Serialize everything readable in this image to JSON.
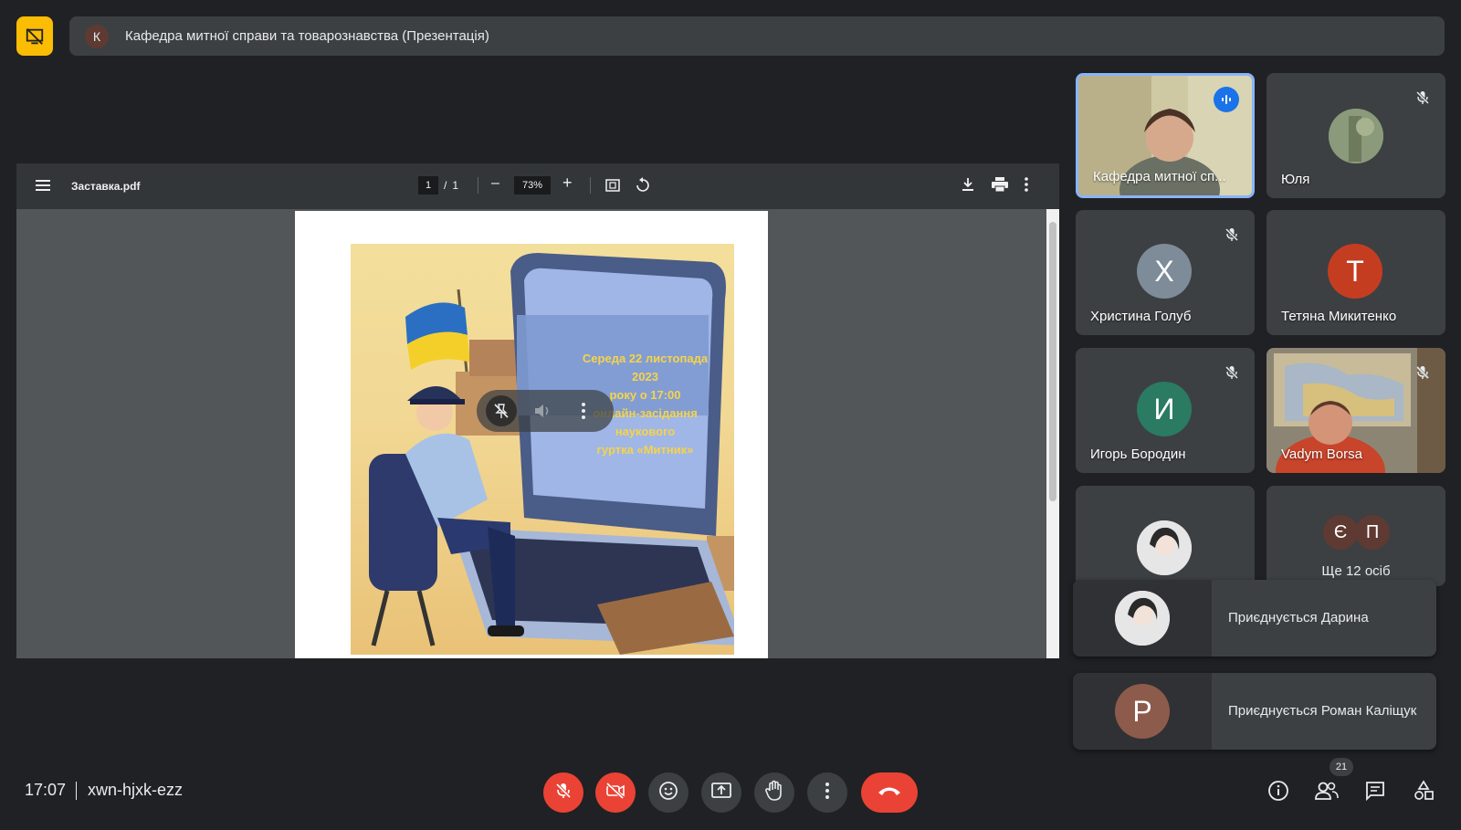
{
  "meeting": {
    "presenter_initial": "К",
    "title": "Кафедра митної справи та товарознавства (Презентація)",
    "time": "17:07",
    "code": "xwn-hjxk-ezz",
    "participant_count": "21"
  },
  "pdf": {
    "filename": "Заставка.pdf",
    "page_current": "1",
    "page_sep": "/",
    "page_total": "1",
    "zoom": "73%",
    "poster_lines": [
      "Середа 22 листопада 2023",
      "року о 17:00",
      "онлайн-засідання наукового",
      "гуртка «Митник»"
    ]
  },
  "tiles": [
    {
      "name": "Кафедра митної сп...",
      "speaking": true
    },
    {
      "name": "Юля",
      "muted": true
    },
    {
      "name": "Христина Голуб",
      "initial": "Х",
      "color": "#7e8b98",
      "muted": true
    },
    {
      "name": "Тетяна Микитенко",
      "initial": "Т",
      "color": "#c53d21"
    },
    {
      "name": "Игорь Бородин",
      "initial": "И",
      "color": "#2b7a62",
      "muted": true
    },
    {
      "name": "Vadym Borsa",
      "muted": true
    },
    {
      "name": ""
    },
    {
      "name": "Ще 12 осіб",
      "initials": [
        "Є",
        "П"
      ]
    }
  ],
  "notifications": [
    {
      "text": "Приєднується Дарина"
    },
    {
      "text": "Приєднується Роман Каліщук",
      "initial": "Р",
      "color": "#8d5b4c"
    }
  ],
  "colors": {
    "background": "#202124",
    "surface": "#3c4043",
    "accent_yellow": "#fbbc04",
    "danger": "#ea4335",
    "active_border": "#8ab4f8"
  }
}
